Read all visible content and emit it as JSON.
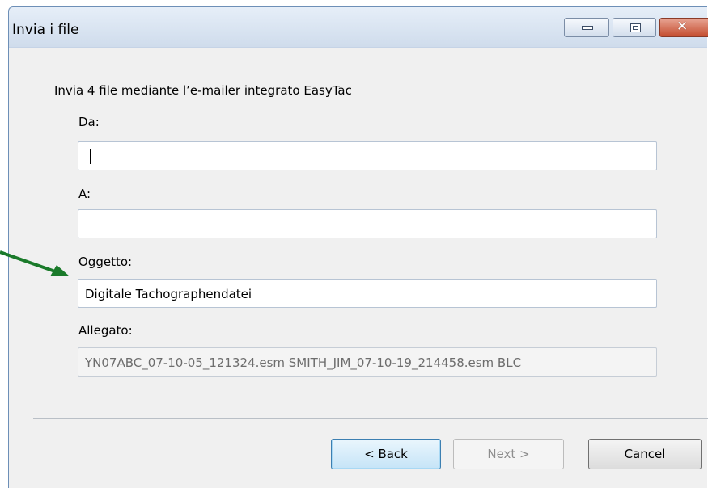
{
  "window": {
    "title": "Invia i file",
    "minimize_label": "minimize",
    "maximize_label": "maximize",
    "close_glyph": "✕"
  },
  "intro": "Invia 4 file mediante l’e-mailer integrato EasyTac",
  "form": {
    "from_label": "Da:",
    "from_value": "",
    "to_label": "A:",
    "to_value": "",
    "subject_label": "Oggetto:",
    "subject_value": "Digitale Tachographendatei",
    "attachment_label": "Allegato:",
    "attachment_value": "YN07ABC_07-10-05_121324.esm SMITH_JIM_07-10-19_214458.esm BLC"
  },
  "buttons": {
    "back": "< Back",
    "next": "Next >",
    "cancel": "Cancel"
  },
  "annotation": {
    "arrow_color": "#1a7a2a",
    "icon": "arrow-icon"
  }
}
